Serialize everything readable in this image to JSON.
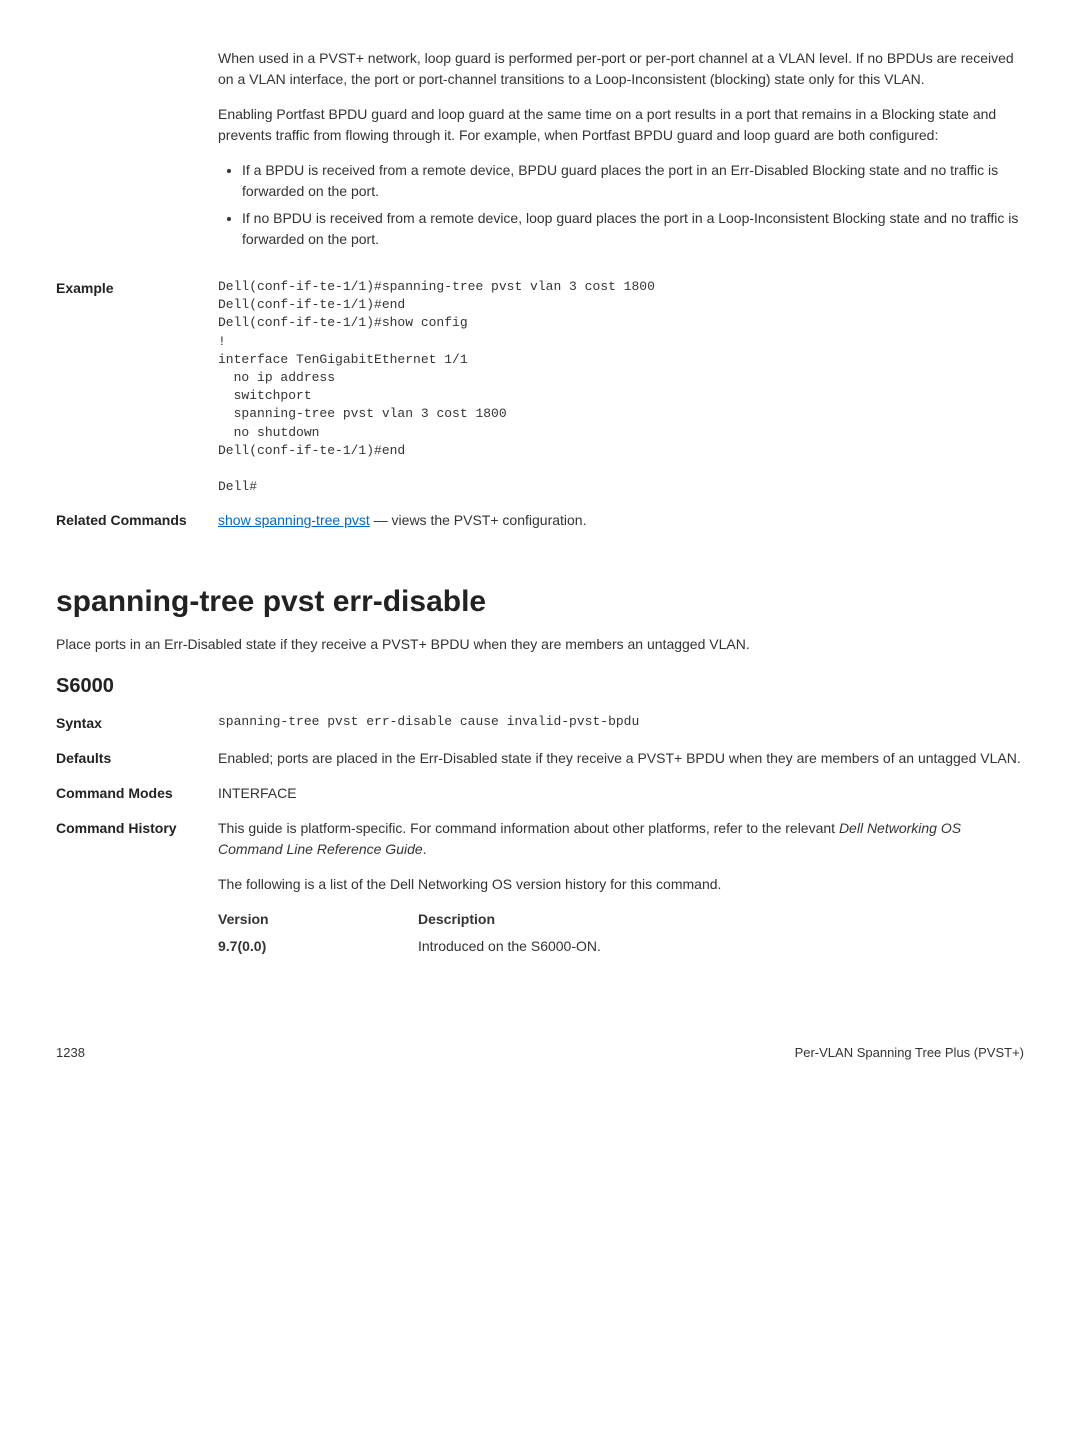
{
  "top": {
    "p1": "When used in a PVST+ network, loop guard is performed per-port or per-port channel at a VLAN level. If no BPDUs are received on a VLAN interface, the port or port-channel transitions to a Loop-Inconsistent (blocking) state only for this VLAN.",
    "p2": "Enabling Portfast BPDU guard and loop guard at the same time on a port results in a port that remains in a Blocking state and prevents traffic from flowing through it. For example, when Portfast BPDU guard and loop guard are both configured:",
    "b1": "If a BPDU is received from a remote device, BPDU guard places the port in an Err-Disabled Blocking state and no traffic is forwarded on the port.",
    "b2": "If no BPDU is received from a remote device, loop guard places the port in a Loop-Inconsistent Blocking state and no traffic is forwarded on the port."
  },
  "example": {
    "label": "Example",
    "code": "Dell(conf-if-te-1/1)#spanning-tree pvst vlan 3 cost 1800\nDell(conf-if-te-1/1)#end\nDell(conf-if-te-1/1)#show config\n!\ninterface TenGigabitEthernet 1/1\n  no ip address\n  switchport\n  spanning-tree pvst vlan 3 cost 1800\n  no shutdown\nDell(conf-if-te-1/1)#end\n\nDell#"
  },
  "related": {
    "label": "Related Commands",
    "link": "show spanning-tree pvst",
    "rest": " — views the PVST+ configuration."
  },
  "section": {
    "heading": "spanning-tree pvst err-disable",
    "intro": "Place ports in an Err-Disabled state if they receive a PVST+ BPDU when they are members an untagged VLAN.",
    "sub": "S6000"
  },
  "syntax": {
    "label": "Syntax",
    "code": "spanning-tree pvst err-disable cause invalid-pvst-bpdu"
  },
  "defaults": {
    "label": "Defaults",
    "text": "Enabled; ports are placed in the Err-Disabled state if they receive a PVST+ BPDU when they are members of an untagged VLAN."
  },
  "modes": {
    "label": "Command Modes",
    "text": "INTERFACE"
  },
  "history": {
    "label": "Command History",
    "p1a": "This guide is platform-specific. For command information about other platforms, refer to the relevant ",
    "p1i": "Dell Networking OS Command Line Reference Guide",
    "p1b": ".",
    "p2": "The following is a list of the Dell Networking OS version history for this command.",
    "vh1": "Version",
    "vh2": "Description",
    "v1": "9.7(0.0)",
    "d1": "Introduced on the S6000-ON."
  },
  "footer": {
    "page": "1238",
    "title": "Per-VLAN Spanning Tree Plus (PVST+)"
  }
}
